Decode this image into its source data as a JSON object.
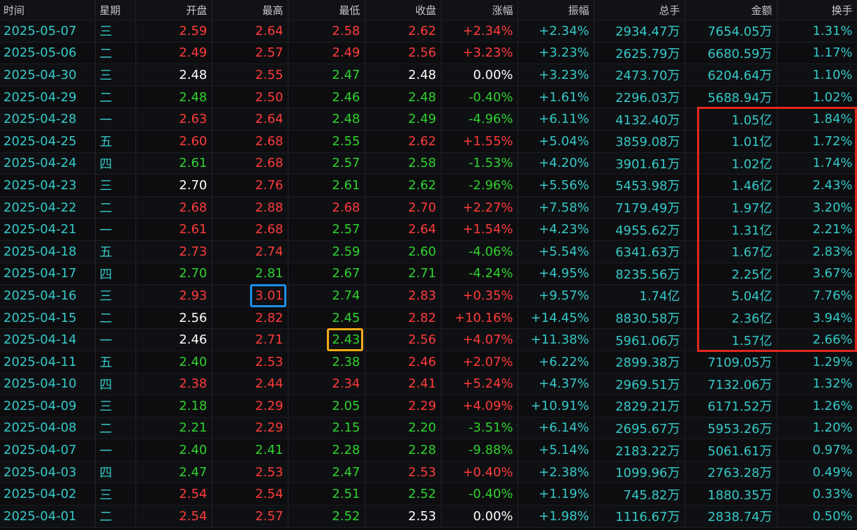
{
  "columns": [
    "时间",
    "星期",
    "开盘",
    "最高",
    "最低",
    "收盘",
    "涨幅",
    "振幅",
    "总手",
    "金额",
    "换手"
  ],
  "colors": {
    "up": "#ff3b3b",
    "down": "#2fd22f",
    "flat": "#ffffff",
    "neutral": "#35c9c8",
    "highlight_red": "#e0281e",
    "highlight_blue": "#1e8fe8",
    "highlight_orange": "#f2aa14"
  },
  "rows": [
    {
      "date": "2025-05-07",
      "weekday": "三",
      "open": "2.59",
      "high": "2.64",
      "low": "2.58",
      "close": "2.62",
      "change": "+2.34%",
      "amplitude": "+2.34%",
      "volume": "2934.47万",
      "amount": "7654.05万",
      "turnover": "1.31%",
      "c": [
        "up",
        "up",
        "up",
        "up",
        "up"
      ]
    },
    {
      "date": "2025-05-06",
      "weekday": "二",
      "open": "2.49",
      "high": "2.57",
      "low": "2.49",
      "close": "2.56",
      "change": "+3.23%",
      "amplitude": "+3.23%",
      "volume": "2625.79万",
      "amount": "6680.59万",
      "turnover": "1.17%",
      "c": [
        "up",
        "up",
        "up",
        "up",
        "up"
      ]
    },
    {
      "date": "2025-04-30",
      "weekday": "三",
      "open": "2.48",
      "high": "2.55",
      "low": "2.47",
      "close": "2.48",
      "change": "0.00%",
      "amplitude": "+3.23%",
      "volume": "2473.70万",
      "amount": "6204.64万",
      "turnover": "1.10%",
      "c": [
        "flat",
        "up",
        "down",
        "flat",
        "flat"
      ]
    },
    {
      "date": "2025-04-29",
      "weekday": "二",
      "open": "2.48",
      "high": "2.50",
      "low": "2.46",
      "close": "2.48",
      "change": "-0.40%",
      "amplitude": "+1.61%",
      "volume": "2296.03万",
      "amount": "5688.94万",
      "turnover": "1.02%",
      "c": [
        "down",
        "up",
        "down",
        "down",
        "down"
      ]
    },
    {
      "date": "2025-04-28",
      "weekday": "一",
      "open": "2.63",
      "high": "2.64",
      "low": "2.48",
      "close": "2.49",
      "change": "-4.96%",
      "amplitude": "+6.11%",
      "volume": "4132.40万",
      "amount": "1.05亿",
      "turnover": "1.84%",
      "c": [
        "up",
        "up",
        "down",
        "down",
        "down"
      ]
    },
    {
      "date": "2025-04-25",
      "weekday": "五",
      "open": "2.60",
      "high": "2.68",
      "low": "2.55",
      "close": "2.62",
      "change": "+1.55%",
      "amplitude": "+5.04%",
      "volume": "3859.08万",
      "amount": "1.01亿",
      "turnover": "1.72%",
      "c": [
        "up",
        "up",
        "down",
        "up",
        "up"
      ]
    },
    {
      "date": "2025-04-24",
      "weekday": "四",
      "open": "2.61",
      "high": "2.68",
      "low": "2.57",
      "close": "2.58",
      "change": "-1.53%",
      "amplitude": "+4.20%",
      "volume": "3901.61万",
      "amount": "1.02亿",
      "turnover": "1.74%",
      "c": [
        "down",
        "up",
        "down",
        "down",
        "down"
      ]
    },
    {
      "date": "2025-04-23",
      "weekday": "三",
      "open": "2.70",
      "high": "2.76",
      "low": "2.61",
      "close": "2.62",
      "change": "-2.96%",
      "amplitude": "+5.56%",
      "volume": "5453.98万",
      "amount": "1.46亿",
      "turnover": "2.43%",
      "c": [
        "flat",
        "up",
        "down",
        "down",
        "down"
      ]
    },
    {
      "date": "2025-04-22",
      "weekday": "二",
      "open": "2.68",
      "high": "2.88",
      "low": "2.68",
      "close": "2.70",
      "change": "+2.27%",
      "amplitude": "+7.58%",
      "volume": "7179.49万",
      "amount": "1.97亿",
      "turnover": "3.20%",
      "c": [
        "up",
        "up",
        "up",
        "up",
        "up"
      ]
    },
    {
      "date": "2025-04-21",
      "weekday": "一",
      "open": "2.61",
      "high": "2.68",
      "low": "2.57",
      "close": "2.64",
      "change": "+1.54%",
      "amplitude": "+4.23%",
      "volume": "4955.62万",
      "amount": "1.31亿",
      "turnover": "2.21%",
      "c": [
        "up",
        "up",
        "down",
        "up",
        "up"
      ]
    },
    {
      "date": "2025-04-18",
      "weekday": "五",
      "open": "2.73",
      "high": "2.74",
      "low": "2.59",
      "close": "2.60",
      "change": "-4.06%",
      "amplitude": "+5.54%",
      "volume": "6341.63万",
      "amount": "1.67亿",
      "turnover": "2.83%",
      "c": [
        "up",
        "up",
        "down",
        "down",
        "down"
      ]
    },
    {
      "date": "2025-04-17",
      "weekday": "四",
      "open": "2.70",
      "high": "2.81",
      "low": "2.67",
      "close": "2.71",
      "change": "-4.24%",
      "amplitude": "+4.95%",
      "volume": "8235.56万",
      "amount": "2.25亿",
      "turnover": "3.67%",
      "c": [
        "down",
        "down",
        "down",
        "down",
        "down"
      ]
    },
    {
      "date": "2025-04-16",
      "weekday": "三",
      "open": "2.93",
      "high": "3.01",
      "low": "2.74",
      "close": "2.83",
      "change": "+0.35%",
      "amplitude": "+9.57%",
      "volume": "1.74亿",
      "amount": "5.04亿",
      "turnover": "7.76%",
      "c": [
        "up",
        "up",
        "down",
        "up",
        "up"
      ]
    },
    {
      "date": "2025-04-15",
      "weekday": "二",
      "open": "2.56",
      "high": "2.82",
      "low": "2.45",
      "close": "2.82",
      "change": "+10.16%",
      "amplitude": "+14.45%",
      "volume": "8830.58万",
      "amount": "2.36亿",
      "turnover": "3.94%",
      "c": [
        "flat",
        "up",
        "down",
        "up",
        "up"
      ]
    },
    {
      "date": "2025-04-14",
      "weekday": "一",
      "open": "2.46",
      "high": "2.71",
      "low": "2.43",
      "close": "2.56",
      "change": "+4.07%",
      "amplitude": "+11.38%",
      "volume": "5961.06万",
      "amount": "1.57亿",
      "turnover": "2.66%",
      "c": [
        "flat",
        "up",
        "down",
        "up",
        "up"
      ]
    },
    {
      "date": "2025-04-11",
      "weekday": "五",
      "open": "2.40",
      "high": "2.53",
      "low": "2.38",
      "close": "2.46",
      "change": "+2.07%",
      "amplitude": "+6.22%",
      "volume": "2899.38万",
      "amount": "7109.05万",
      "turnover": "1.29%",
      "c": [
        "down",
        "up",
        "down",
        "up",
        "up"
      ]
    },
    {
      "date": "2025-04-10",
      "weekday": "四",
      "open": "2.38",
      "high": "2.44",
      "low": "2.34",
      "close": "2.41",
      "change": "+5.24%",
      "amplitude": "+4.37%",
      "volume": "2969.51万",
      "amount": "7132.06万",
      "turnover": "1.32%",
      "c": [
        "up",
        "up",
        "up",
        "up",
        "up"
      ]
    },
    {
      "date": "2025-04-09",
      "weekday": "三",
      "open": "2.18",
      "high": "2.29",
      "low": "2.05",
      "close": "2.29",
      "change": "+4.09%",
      "amplitude": "+10.91%",
      "volume": "2829.21万",
      "amount": "6171.52万",
      "turnover": "1.26%",
      "c": [
        "down",
        "up",
        "down",
        "up",
        "up"
      ]
    },
    {
      "date": "2025-04-08",
      "weekday": "二",
      "open": "2.21",
      "high": "2.29",
      "low": "2.15",
      "close": "2.20",
      "change": "-3.51%",
      "amplitude": "+6.14%",
      "volume": "2695.67万",
      "amount": "5953.26万",
      "turnover": "1.20%",
      "c": [
        "down",
        "up",
        "down",
        "down",
        "down"
      ]
    },
    {
      "date": "2025-04-07",
      "weekday": "一",
      "open": "2.40",
      "high": "2.41",
      "low": "2.28",
      "close": "2.28",
      "change": "-9.88%",
      "amplitude": "+5.14%",
      "volume": "2183.22万",
      "amount": "5061.61万",
      "turnover": "0.97%",
      "c": [
        "down",
        "down",
        "down",
        "down",
        "down"
      ]
    },
    {
      "date": "2025-04-03",
      "weekday": "四",
      "open": "2.47",
      "high": "2.53",
      "low": "2.47",
      "close": "2.53",
      "change": "+0.40%",
      "amplitude": "+2.38%",
      "volume": "1099.96万",
      "amount": "2763.28万",
      "turnover": "0.49%",
      "c": [
        "down",
        "up",
        "down",
        "up",
        "up"
      ]
    },
    {
      "date": "2025-04-02",
      "weekday": "三",
      "open": "2.54",
      "high": "2.54",
      "low": "2.51",
      "close": "2.52",
      "change": "-0.40%",
      "amplitude": "+1.19%",
      "volume": "745.82万",
      "amount": "1880.35万",
      "turnover": "0.33%",
      "c": [
        "up",
        "up",
        "down",
        "down",
        "down"
      ]
    },
    {
      "date": "2025-04-01",
      "weekday": "二",
      "open": "2.54",
      "high": "2.57",
      "low": "2.52",
      "close": "2.53",
      "change": "0.00%",
      "amplitude": "+1.98%",
      "volume": "1116.67万",
      "amount": "2838.74万",
      "turnover": "0.50%",
      "c": [
        "up",
        "up",
        "down",
        "flat",
        "flat"
      ]
    }
  ],
  "highlights": [
    {
      "name": "amount-turnover-highlight",
      "color": "highlight_red",
      "from_row": "2025-04-28",
      "to_row": "2025-04-14",
      "columns": [
        "金额",
        "换手"
      ]
    },
    {
      "name": "high-cell-highlight",
      "color": "highlight_blue",
      "row": "2025-04-16",
      "column": "最高"
    },
    {
      "name": "low-cell-highlight",
      "color": "highlight_orange",
      "row": "2025-04-14",
      "column": "最低"
    }
  ]
}
